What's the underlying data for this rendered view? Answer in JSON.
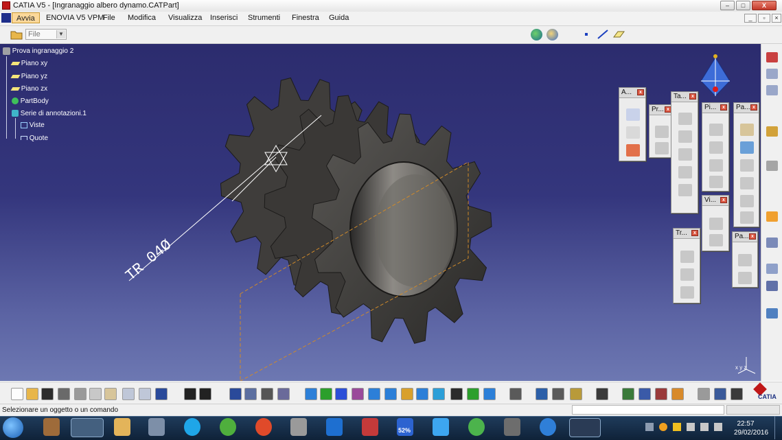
{
  "window": {
    "title": "CATIA V5 - [Ingranaggio albero dynamo.CATPart]",
    "min": "–",
    "max": "□",
    "close": "X"
  },
  "menu": {
    "items": [
      "Avvia",
      "ENOVIA V5 VPM",
      "File",
      "Modifica",
      "Visualizza",
      "Inserisci",
      "Strumenti",
      "Finestra",
      "Guida"
    ]
  },
  "toolbar_top": {
    "combo_value": "File"
  },
  "tree": {
    "root": "Prova ingranaggio 2",
    "items": [
      "Piano xy",
      "Piano yz",
      "Piano zx",
      "PartBody",
      "Serie di annotazioni.1",
      "Viste",
      "Quote"
    ]
  },
  "annotation": {
    "text": "TR 04Ø"
  },
  "palettes": {
    "a": "A...",
    "pr": "Pr...",
    "ta": "Ta...",
    "pi": "Pi...",
    "pa1": "Pa...",
    "vi": "Vi...",
    "tr": "Tr...",
    "pa2": "Pa..."
  },
  "status": {
    "message": "Selezionare un oggetto o un comando"
  },
  "taskbar": {
    "time": "22:57",
    "date": "29/02/2016",
    "badge": "52%"
  },
  "compass_label": "x y z",
  "brand": "CATIA",
  "colors": {
    "viewport_top": "#2c2c6e",
    "viewport_bottom": "#6d78b2",
    "gear": "#3a3836",
    "menu_active": "#fbd89a",
    "taskbar": "#1a3352"
  }
}
